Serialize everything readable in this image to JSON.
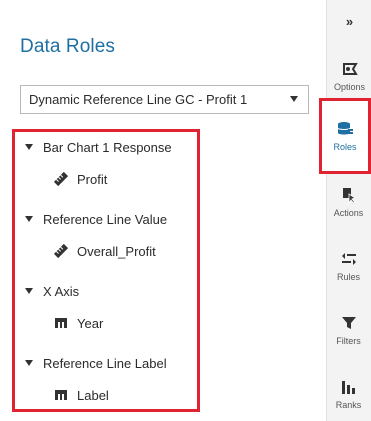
{
  "panel": {
    "title": "Data Roles",
    "selected_object": "Dynamic Reference Line GC - Profit 1"
  },
  "roles": [
    {
      "label": "Bar Chart 1 Response",
      "item": {
        "label": "Profit",
        "icon": "measure-ruler-icon"
      }
    },
    {
      "label": "Reference Line Value",
      "item": {
        "label": "Overall_Profit",
        "icon": "measure-ruler-icon"
      }
    },
    {
      "label": "X Axis",
      "item": {
        "label": "Year",
        "icon": "category-icon"
      }
    },
    {
      "label": "Reference Line Label",
      "item": {
        "label": "Label",
        "icon": "category-icon"
      }
    }
  ],
  "sidebar": {
    "collapse_glyph": "»",
    "items": [
      {
        "label": "Options",
        "icon": "options-icon",
        "active": false
      },
      {
        "label": "Roles",
        "icon": "roles-icon",
        "active": true
      },
      {
        "label": "Actions",
        "icon": "actions-icon",
        "active": false
      },
      {
        "label": "Rules",
        "icon": "rules-icon",
        "active": false
      },
      {
        "label": "Filters",
        "icon": "filter-icon",
        "active": false
      },
      {
        "label": "Ranks",
        "icon": "ranks-icon",
        "active": false
      }
    ]
  },
  "colors": {
    "accent": "#1f6fa3",
    "highlight": "#e02332",
    "sidebar_bg": "#f3f3f3"
  }
}
